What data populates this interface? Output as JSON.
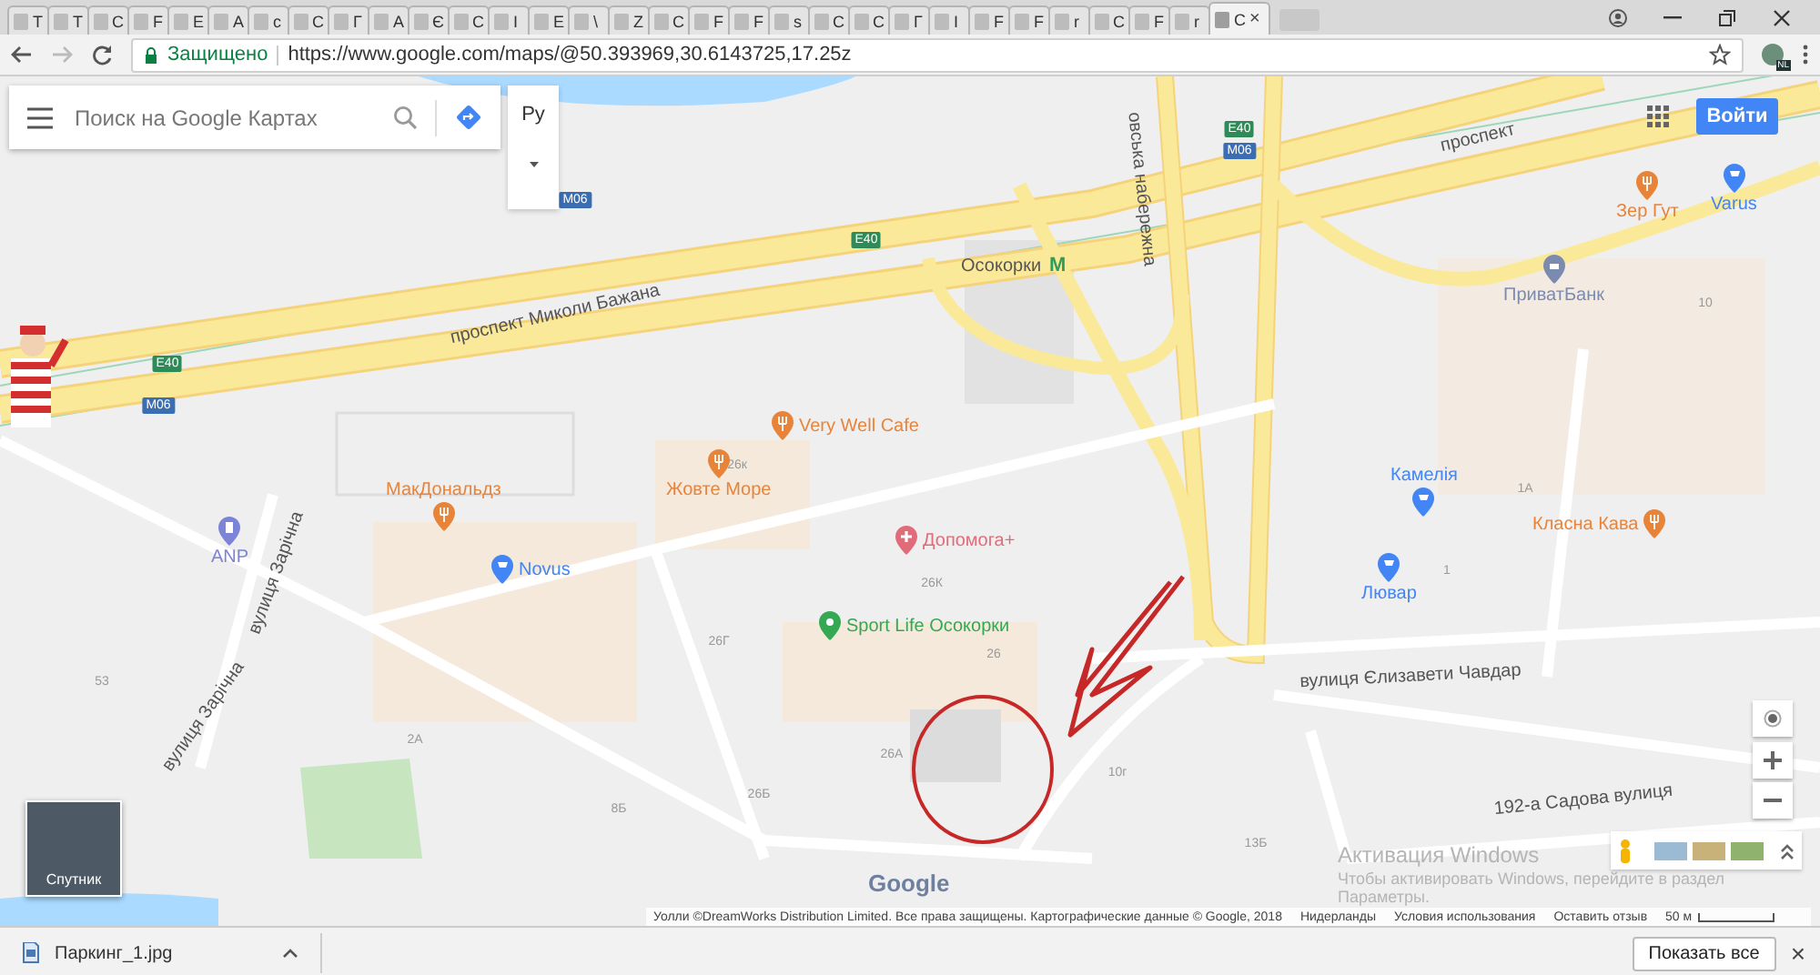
{
  "browser": {
    "tabs": [
      {
        "label": "Т",
        "selected": false
      },
      {
        "label": "Т",
        "selected": false
      },
      {
        "label": "С",
        "selected": false
      },
      {
        "label": "F",
        "selected": false
      },
      {
        "label": "Е",
        "selected": false
      },
      {
        "label": "А",
        "selected": false
      },
      {
        "label": "с",
        "selected": false
      },
      {
        "label": "С",
        "selected": false
      },
      {
        "label": "Г",
        "selected": false
      },
      {
        "label": "А",
        "selected": false
      },
      {
        "label": "Є",
        "selected": false
      },
      {
        "label": "С",
        "selected": false
      },
      {
        "label": "I",
        "selected": false
      },
      {
        "label": "Е",
        "selected": false
      },
      {
        "label": "\\",
        "selected": false
      },
      {
        "label": "Z",
        "selected": false
      },
      {
        "label": "С",
        "selected": false
      },
      {
        "label": "F",
        "selected": false
      },
      {
        "label": "F",
        "selected": false
      },
      {
        "label": "s",
        "selected": false
      },
      {
        "label": "С",
        "selected": false
      },
      {
        "label": "С",
        "selected": false
      },
      {
        "label": "Г",
        "selected": false
      },
      {
        "label": "I",
        "selected": false
      },
      {
        "label": "F",
        "selected": false
      },
      {
        "label": "F",
        "selected": false
      },
      {
        "label": "r",
        "selected": false
      },
      {
        "label": "С",
        "selected": false
      },
      {
        "label": "F",
        "selected": false
      },
      {
        "label": "r",
        "selected": false
      },
      {
        "label": "С",
        "selected": true
      }
    ],
    "close_tab": "×",
    "secure_label": "Защищено",
    "url": "https://www.google.com/maps/@50.393969,30.6143725,17.25z",
    "profile_badge": "NL"
  },
  "map": {
    "search": {
      "placeholder": "Поиск на Google Картах"
    },
    "language": "Ру",
    "sign_in": "Войти",
    "places": [
      {
        "name": "Осокорки",
        "kind": "metro",
        "color": "#2e9d5b",
        "sign": "M"
      },
      {
        "name": "Very Well Cafe",
        "kind": "food",
        "color": "#e8833a"
      },
      {
        "name": "Жовте Море",
        "kind": "food",
        "color": "#e8833a"
      },
      {
        "name": "МакДональдз",
        "kind": "food",
        "color": "#e8833a"
      },
      {
        "name": "Novus",
        "kind": "shop",
        "color": "#4285f4"
      },
      {
        "name": "ANP",
        "kind": "fuel",
        "color": "#7b84d6"
      },
      {
        "name": "Допомога+",
        "kind": "health",
        "color": "#e06c7a"
      },
      {
        "name": "Sport Life Осокорки",
        "kind": "sport",
        "color": "#34a853"
      },
      {
        "name": "Зер Гут",
        "kind": "food",
        "color": "#e8833a"
      },
      {
        "name": "Varus",
        "kind": "shop",
        "color": "#4285f4"
      },
      {
        "name": "ПриватБанк",
        "kind": "bank",
        "color": "#7b8bb0"
      },
      {
        "name": "Камелія",
        "kind": "shop",
        "color": "#4285f4"
      },
      {
        "name": "Класна Кава",
        "kind": "food",
        "color": "#e8833a"
      },
      {
        "name": "Лювар",
        "kind": "shop",
        "color": "#4285f4"
      }
    ],
    "streets": [
      "проспект Миколи Бажана",
      "проспект",
      "овська набережна",
      "вулиця Єлизавети Чавдар",
      "вулиця Зарічна",
      "вулиця Зарічна",
      "192-а Садова вулиця"
    ],
    "route_shields": [
      {
        "label": "E40",
        "kind": "european"
      },
      {
        "label": "M06",
        "kind": "national"
      },
      {
        "label": "E40",
        "kind": "european"
      },
      {
        "label": "M06",
        "kind": "national"
      },
      {
        "label": "E40",
        "kind": "european"
      },
      {
        "label": "M06",
        "kind": "national"
      }
    ],
    "building_numbers": [
      "26к",
      "26К",
      "26Г",
      "26",
      "26А",
      "26Б",
      "8Б",
      "2А",
      "53",
      "10г",
      "13Б",
      "10",
      "1А",
      "1"
    ],
    "layer_button": "Спутник",
    "logo": "Google",
    "attribution": "Уолли ©DreamWorks Distribution Limited. Все права защищены. Картографические данные © Google, 2018",
    "region": "Нидерланды",
    "terms": "Условия использования",
    "feedback": "Оставить отзыв",
    "scale": "50 м"
  },
  "windows_notice": {
    "title": "Активация Windows",
    "line": "Чтобы активировать Windows, перейдите в раздел",
    "link": "Параметры."
  },
  "download_bar": {
    "file": "Паркинг_1.jpg",
    "show_all": "Показать все",
    "close": "×"
  }
}
